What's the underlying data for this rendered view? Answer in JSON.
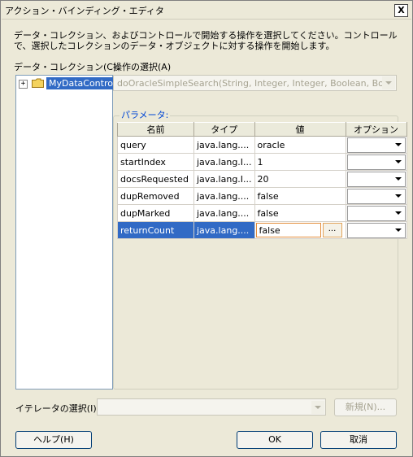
{
  "window": {
    "title": "アクション・バインディング・エディタ",
    "close_label": "X"
  },
  "description": "データ・コレクション、およびコントロールで開始する操作を選択してください。コントロールで、選択したコレクションのデータ・オブジェクトに対する操作を開始します。",
  "data_collection": {
    "label": "データ・コレクション(C):",
    "expander": "+",
    "tree_item": "MyDataControl"
  },
  "operation": {
    "label": "操作の選択(A)",
    "value": "doOracleSimpleSearch(String, Integer, Integer, Boolean, Boolea..."
  },
  "params": {
    "group_label": "パラメータ:",
    "columns": [
      "名前",
      "タイプ",
      "値",
      "オプション"
    ],
    "rows": [
      {
        "name": "query",
        "type": "java.lang....",
        "value": "oracle"
      },
      {
        "name": "startIndex",
        "type": "java.lang.I...",
        "value": "1"
      },
      {
        "name": "docsRequested",
        "type": "java.lang.I...",
        "value": "20"
      },
      {
        "name": "dupRemoved",
        "type": "java.lang....",
        "value": "false"
      },
      {
        "name": "dupMarked",
        "type": "java.lang....",
        "value": "false"
      },
      {
        "name": "returnCount",
        "type": "java.lang....",
        "value": "false"
      }
    ],
    "ellipsis": "..."
  },
  "iterator": {
    "label": "イテレータの選択(I):",
    "value": ""
  },
  "buttons": {
    "new": "新規(N)...",
    "help": "ヘルプ(H)",
    "ok": "OK",
    "cancel": "取消"
  },
  "colors": {
    "selection": "#316ac5",
    "group_label": "#0046d5",
    "background": "#ece9d8"
  }
}
